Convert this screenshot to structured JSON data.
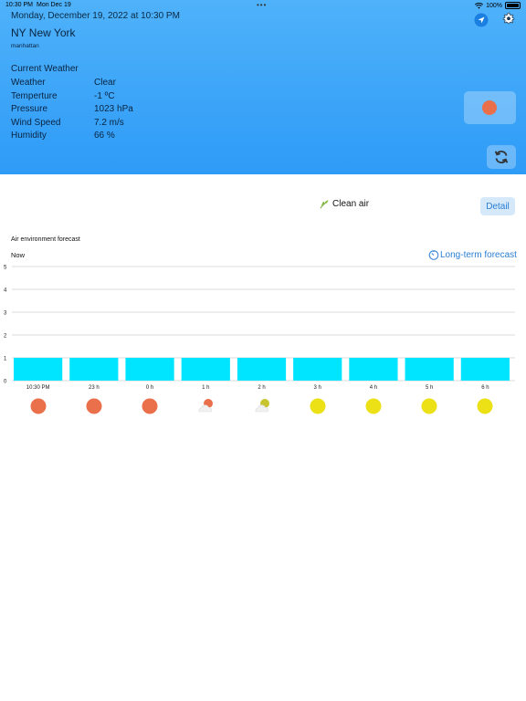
{
  "status_bar": {
    "time": "10:30 PM",
    "date": "Mon Dec 19",
    "battery": "100%"
  },
  "header": {
    "datetime": "Monday, December 19, 2022 at 10:30 PM",
    "city": "NY New York",
    "district": "manhattan",
    "section_title": "Current Weather",
    "rows": [
      {
        "label": "Weather",
        "value": "Clear"
      },
      {
        "label": "Temperture",
        "value": "-1 ºC"
      },
      {
        "label": "Pressure",
        "value": "1023 hPa"
      },
      {
        "label": "Wind Speed",
        "value": "7.2 m/s"
      },
      {
        "label": "Humidity",
        "value": "66 %"
      }
    ],
    "colors": {
      "background": "#2e9bf7",
      "status_dot": "#ea6f4b"
    }
  },
  "air": {
    "status": "Clean air",
    "status_icon": "leaf-icon",
    "detail_label": "Detail"
  },
  "forecast": {
    "title": "Air environment forecast",
    "now_label": "Now",
    "longterm_label": "Long-term forecast"
  },
  "chart_data": {
    "type": "bar",
    "categories": [
      "10:30 PM",
      "23 h",
      "0 h",
      "1 h",
      "2 h",
      "3 h",
      "4 h",
      "5 h",
      "6 h"
    ],
    "values": [
      1,
      1,
      1,
      1,
      1,
      1,
      1,
      1,
      1
    ],
    "y_ticks": [
      "0",
      "1",
      "2",
      "3",
      "4",
      "5"
    ],
    "ylim": [
      0,
      5
    ],
    "grid": true,
    "bar_color": "#00e5ff"
  },
  "forecast_icons": [
    {
      "icon": "clear-night-icon",
      "color": "#ea6f4b"
    },
    {
      "icon": "clear-night-icon",
      "color": "#ea6f4b"
    },
    {
      "icon": "clear-night-icon",
      "color": "#ea6f4b"
    },
    {
      "icon": "partly-cloudy-icon",
      "color": "#ea6f4b"
    },
    {
      "icon": "partly-cloudy-icon",
      "color": "#c7c430"
    },
    {
      "icon": "sun-icon",
      "color": "#ece017"
    },
    {
      "icon": "sun-icon",
      "color": "#ece017"
    },
    {
      "icon": "sun-icon",
      "color": "#ece017"
    },
    {
      "icon": "sun-icon",
      "color": "#ece017"
    }
  ]
}
